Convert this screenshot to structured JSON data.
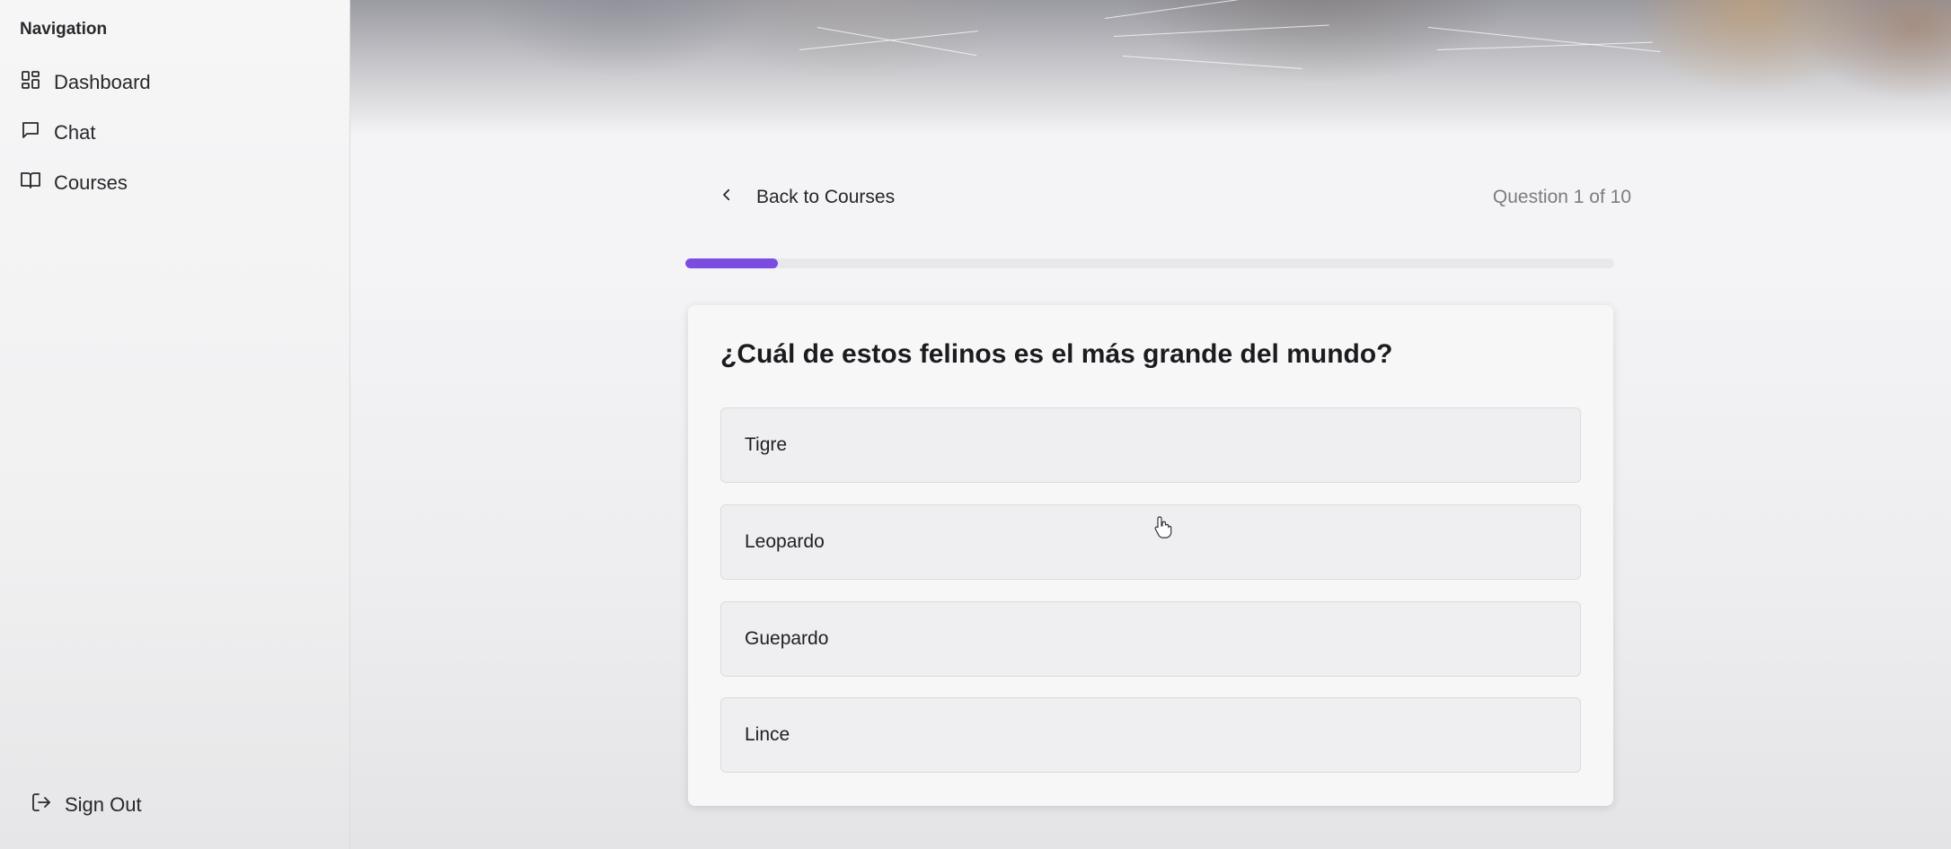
{
  "sidebar": {
    "heading": "Navigation",
    "items": [
      {
        "label": "Dashboard",
        "icon": "dashboard-icon"
      },
      {
        "label": "Chat",
        "icon": "chat-icon"
      },
      {
        "label": "Courses",
        "icon": "book-icon"
      }
    ],
    "sign_out_label": "Sign Out"
  },
  "quiz": {
    "back_label": "Back to Courses",
    "counter": "Question 1 of 10",
    "progress_fraction": 0.1,
    "question": "¿Cuál de estos felinos es el más grande del mundo?",
    "options": [
      "Tigre",
      "Leopardo",
      "Guepardo",
      "Lince"
    ]
  },
  "colors": {
    "accent": "#7b4ce0"
  }
}
